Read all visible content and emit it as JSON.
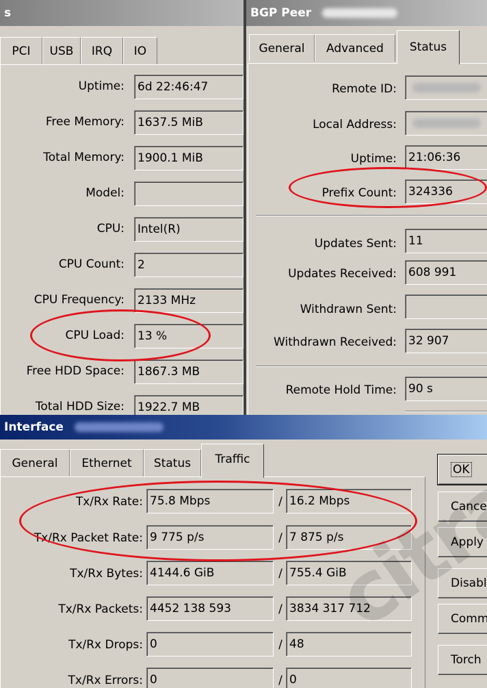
{
  "resources": {
    "title": "s",
    "tabs": [
      "PCI",
      "USB",
      "IRQ",
      "IO"
    ],
    "fields": [
      {
        "label": "Uptime:",
        "value": "6d 22:46:47"
      },
      {
        "label": "Free Memory:",
        "value": "1637.5 MiB"
      },
      {
        "label": "Total Memory:",
        "value": "1900.1 MiB"
      },
      {
        "label": "Model:",
        "value": ""
      },
      {
        "label": "CPU:",
        "value": "Intel(R)"
      },
      {
        "label": "CPU Count:",
        "value": "2"
      },
      {
        "label": "CPU Frequency:",
        "value": "2133 MHz"
      },
      {
        "label": "CPU Load:",
        "value": "13 %"
      },
      {
        "label": "Free HDD Space:",
        "value": "1867.3 MB"
      },
      {
        "label": "Total HDD Size:",
        "value": "1922.7 MB"
      }
    ]
  },
  "bgp": {
    "title": "BGP Peer",
    "tabs": [
      "General",
      "Advanced",
      "Status"
    ],
    "active_tab": "Status",
    "fields": [
      {
        "label": "Remote ID:",
        "value": ""
      },
      {
        "label": "Local Address:",
        "value": ""
      },
      {
        "label": "Uptime:",
        "value": "21:06:36"
      },
      {
        "label": "Prefix Count:",
        "value": "324336"
      },
      {
        "label": "Updates Sent:",
        "value": "11"
      },
      {
        "label": "Updates Received:",
        "value": "608 991"
      },
      {
        "label": "Withdrawn Sent:",
        "value": ""
      },
      {
        "label": "Withdrawn Received:",
        "value": "32 907"
      },
      {
        "label": "Remote Hold Time:",
        "value": "90 s"
      }
    ]
  },
  "interface": {
    "title": "Interface",
    "tabs": [
      "General",
      "Ethernet",
      "Status",
      "Traffic"
    ],
    "active_tab": "Traffic",
    "rows": [
      {
        "label": "Tx/Rx Rate:",
        "tx": "75.8 Mbps",
        "rx": "16.2 Mbps"
      },
      {
        "label": "Tx/Rx Packet Rate:",
        "tx": "9 775 p/s",
        "rx": "7 875 p/s"
      },
      {
        "label": "Tx/Rx Bytes:",
        "tx": "4144.6 GiB",
        "rx": "755.4 GiB"
      },
      {
        "label": "Tx/Rx Packets:",
        "tx": "4452 138 593",
        "rx": "3834 317 712"
      },
      {
        "label": "Tx/Rx Drops:",
        "tx": "0",
        "rx": "48"
      },
      {
        "label": "Tx/Rx Errors:",
        "tx": "0",
        "rx": "0"
      }
    ],
    "separator": "/",
    "buttons": [
      "OK",
      "Cancel",
      "Apply",
      "Disable",
      "Comment",
      "Torch"
    ]
  },
  "colors": {
    "face": "#d4d0c8",
    "title_dark": "#0a246a",
    "title_light": "#a6caf0",
    "title_inactive": "#808080",
    "highlight": "#e0141c"
  },
  "watermark": {
    "text": "citra"
  }
}
